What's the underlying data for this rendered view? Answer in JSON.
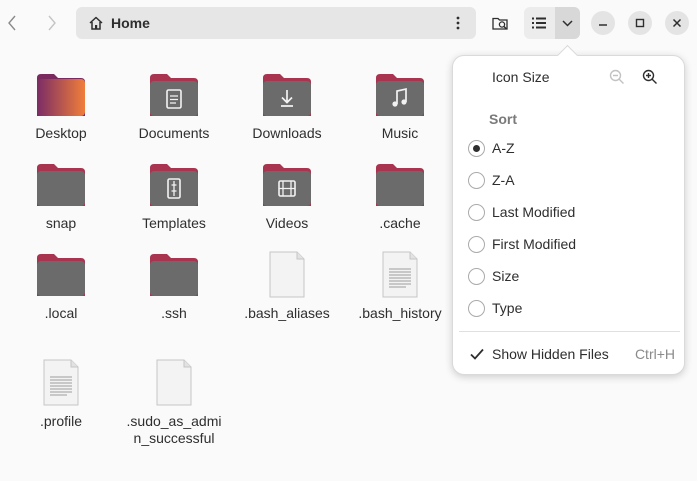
{
  "header": {
    "location": "Home",
    "back_icon": "chevron-left-icon",
    "forward_icon": "chevron-right-icon",
    "home_icon": "home-icon",
    "path_menu_icon": "vertical-ellipsis-icon",
    "search_icon": "search-folder-icon",
    "view_icon": "list-view-icon",
    "view_options_icon": "chevron-down-icon",
    "window_controls": [
      "minimize-icon",
      "maximize-icon",
      "close-icon"
    ]
  },
  "colors": {
    "folder_body": "#6b6b6b",
    "folder_tab": "#a8344f",
    "desktop_gradient": [
      "#7b2c66",
      "#f07e3a"
    ],
    "file_bg": "#f3f3f3",
    "popover_bg": "#ffffff",
    "window_bg": "#fafafa"
  },
  "files": [
    {
      "name": "Desktop",
      "icon": "desktop-folder-icon"
    },
    {
      "name": "Documents",
      "icon": "documents-folder-icon"
    },
    {
      "name": "Downloads",
      "icon": "downloads-folder-icon"
    },
    {
      "name": "Music",
      "icon": "music-folder-icon"
    },
    {
      "name": "snap",
      "icon": "folder-icon"
    },
    {
      "name": "Templates",
      "icon": "templates-folder-icon"
    },
    {
      "name": "Videos",
      "icon": "videos-folder-icon"
    },
    {
      "name": ".cache",
      "icon": "folder-icon"
    },
    {
      "name": ".local",
      "icon": "folder-icon"
    },
    {
      "name": ".ssh",
      "icon": "folder-icon"
    },
    {
      "name": ".bash_aliases",
      "icon": "blank-file-icon"
    },
    {
      "name": ".bash_history",
      "icon": "text-file-icon"
    },
    {
      "name": ".profile",
      "icon": "text-file-icon"
    },
    {
      "name": ".sudo_as_admin_successful",
      "icon": "blank-file-icon"
    }
  ],
  "popover": {
    "icon_size_label": "Icon Size",
    "zoom_out_icon": "zoom-out-icon",
    "zoom_in_icon": "zoom-in-icon",
    "sort_heading": "Sort",
    "sort_options": [
      "A-Z",
      "Z-A",
      "Last Modified",
      "First Modified",
      "Size",
      "Type"
    ],
    "selected_sort": "A-Z",
    "show_hidden_label": "Show Hidden Files",
    "show_hidden_checked": true,
    "show_hidden_shortcut": "Ctrl+H"
  }
}
